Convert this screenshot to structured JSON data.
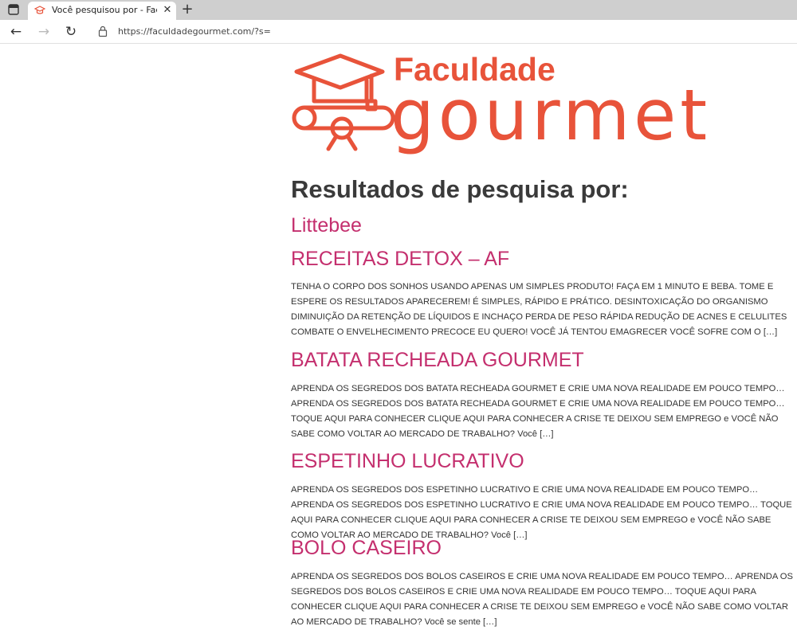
{
  "browser": {
    "tab_title": "Você pesquisou por - Faculdade Gourmet",
    "tab_close": "✕",
    "new_tab": "+",
    "url": "https://faculdadegourmet.com/?s="
  },
  "logo": {
    "line1": "Faculdade",
    "line2": "gourmet",
    "color": "#e8533a"
  },
  "page": {
    "heading": "Resultados de pesquisa por:",
    "accent": "#c42f6e"
  },
  "results": [
    {
      "title": "Littebee",
      "excerpt": ""
    },
    {
      "title": "RECEITAS DETOX – AF",
      "excerpt": "TENHA O CORPO DOS SONHOS USANDO APENAS UM SIMPLES PRODUTO! FAÇA EM 1 MINUTO E BEBA. TOME E ESPERE OS RESULTADOS APARECEREM! É SIMPLES, RÁPIDO E PRÁTICO. DESINTOXICAÇÃO DO ORGANISMO DIMINUIÇÃO DA RETENÇÃO DE LÍQUIDOS E INCHAÇO PERDA DE PESO RÁPIDA REDUÇÃO DE ACNES E CELULITES COMBATE O ENVELHECIMENTO PRECOCE EU QUERO! VOCÊ JÁ TENTOU EMAGRECER VOCÊ SOFRE COM O […]"
    },
    {
      "title": "BATATA RECHEADA GOURMET",
      "excerpt": "APRENDA OS SEGREDOS DOS BATATA RECHEADA GOURMET E CRIE UMA NOVA REALIDADE EM POUCO TEMPO… APRENDA OS SEGREDOS DOS BATATA RECHEADA GOURMET E CRIE UMA NOVA REALIDADE EM POUCO TEMPO… TOQUE AQUI PARA CONHECER CLIQUE AQUI PARA CONHECER A CRISE TE DEIXOU SEM EMPREGO e VOCÊ NÃO SABE COMO VOLTAR AO MERCADO DE TRABALHO? Você […]"
    },
    {
      "title": "ESPETINHO LUCRATIVO",
      "excerpt": "APRENDA OS SEGREDOS DOS ESPETINHO LUCRATIVO E CRIE UMA NOVA REALIDADE EM POUCO TEMPO… APRENDA OS SEGREDOS DOS ESPETINHO LUCRATIVO E CRIE UMA NOVA REALIDADE EM POUCO TEMPO… TOQUE AQUI PARA CONHECER CLIQUE AQUI PARA CONHECER A CRISE TE DEIXOU SEM EMPREGO e VOCÊ NÃO SABE COMO VOLTAR AO MERCADO DE TRABALHO? Você […]"
    },
    {
      "title": "BOLO CASEIRO",
      "excerpt": "APRENDA OS SEGREDOS DOS BOLOS CASEIROS E CRIE UMA NOVA REALIDADE EM POUCO TEMPO… APRENDA OS SEGREDOS DOS BOLOS CASEIROS E CRIE UMA NOVA REALIDADE EM POUCO TEMPO… TOQUE AQUI PARA CONHECER CLIQUE AQUI PARA CONHECER A CRISE TE DEIXOU SEM EMPREGO e VOCÊ NÃO SABE COMO VOLTAR AO MERCADO DE TRABALHO? Você se sente […]"
    }
  ]
}
